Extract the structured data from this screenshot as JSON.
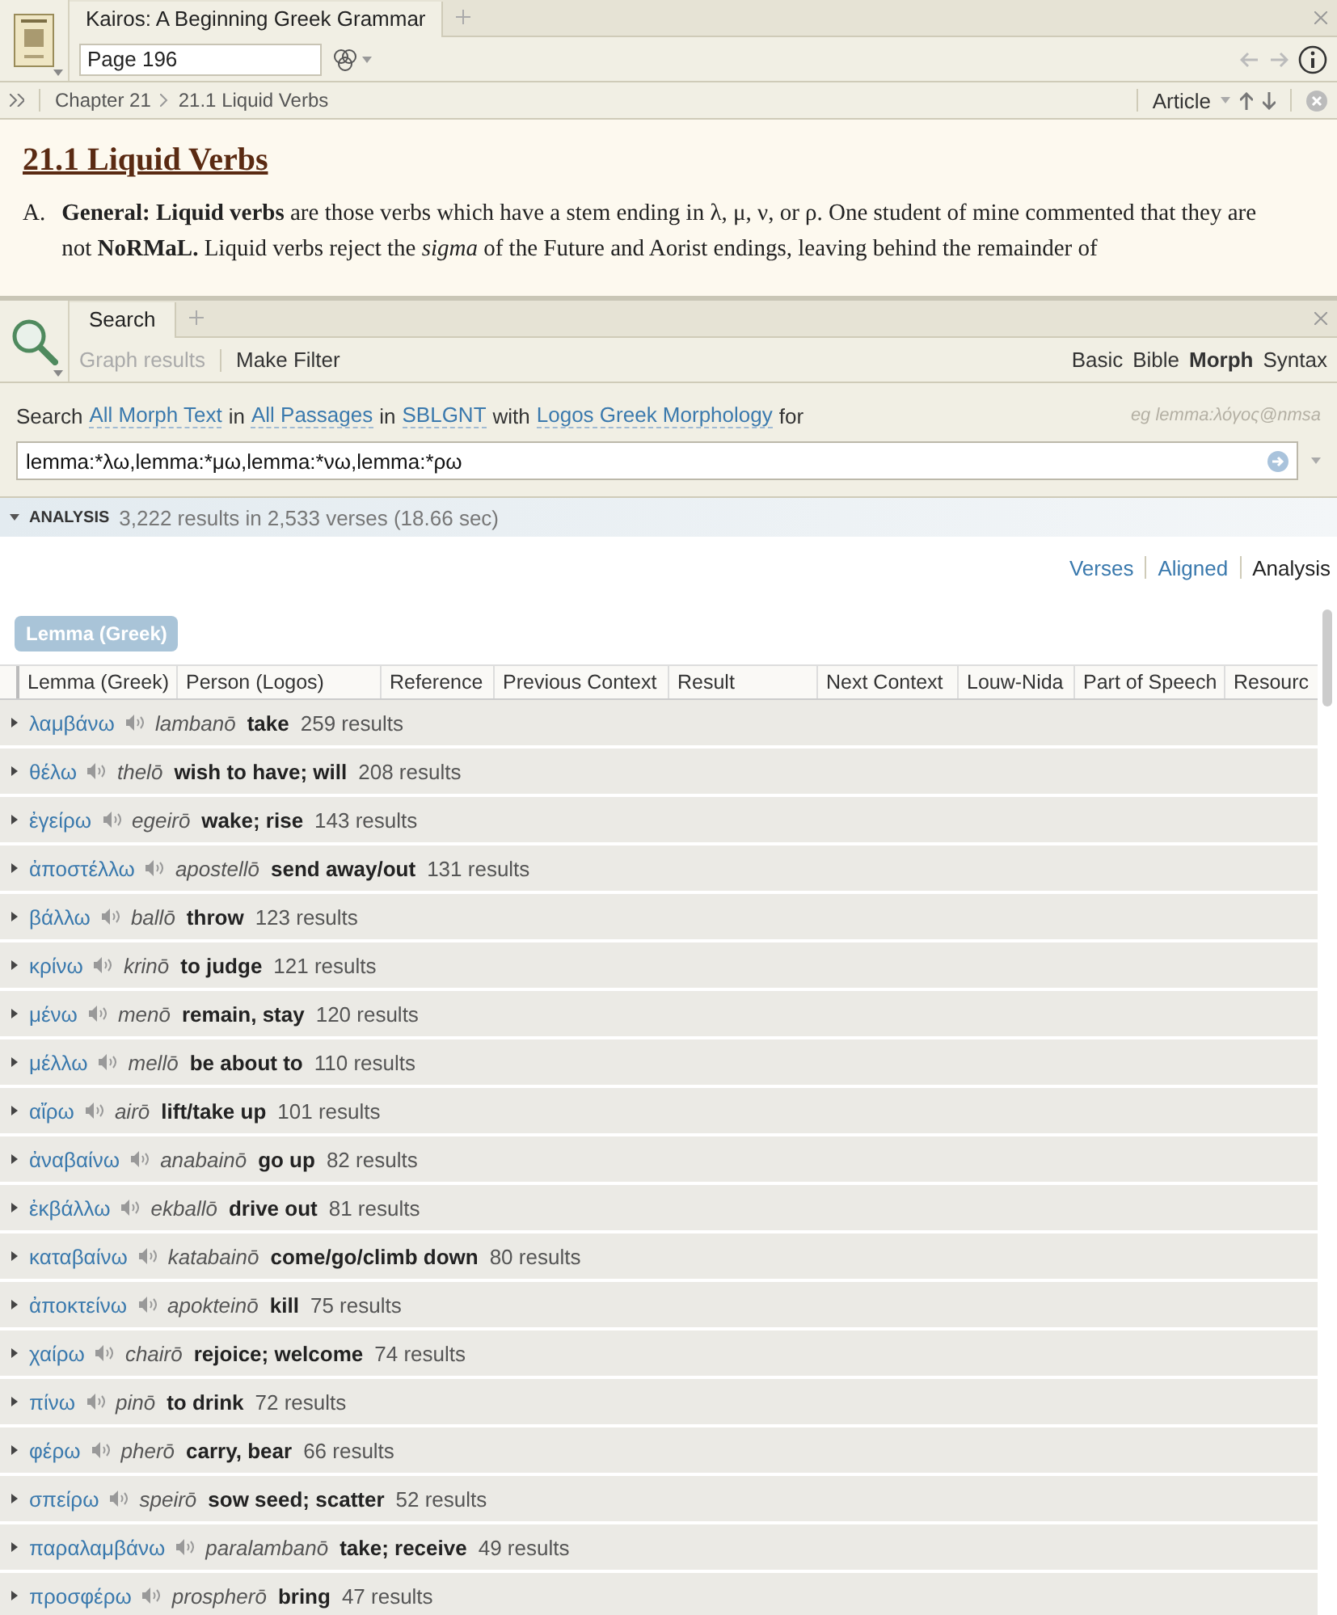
{
  "book_panel": {
    "tab": "Kairos: A Beginning Greek Grammar",
    "page": "Page 196",
    "breadcrumb": [
      "Chapter 21",
      "21.1 Liquid Verbs"
    ],
    "view": "Article",
    "heading": "21.1 Liquid Verbs",
    "paragraph_marker": "A.",
    "paragraph": "**General: Liquid verbs** are those verbs which have a stem ending in λ, μ, ν, or ρ. One student of mine commented that they are not **NoRMaL.** Liquid verbs reject the *sigma* of the Future and Aorist endings, leaving behind the remainder of"
  },
  "search_panel": {
    "tab": "Search",
    "graph_results": {
      "label": "Graph results",
      "disabled": true
    },
    "make_filter": {
      "label": "Make Filter",
      "disabled": false
    },
    "modes": [
      {
        "label": "Basic",
        "selected": false
      },
      {
        "label": "Bible",
        "selected": false
      },
      {
        "label": "Morph",
        "selected": true
      },
      {
        "label": "Syntax",
        "selected": false
      }
    ],
    "query_line": [
      {
        "kind": "text",
        "text": "Search"
      },
      {
        "kind": "link",
        "text": "All Morph Text"
      },
      {
        "kind": "text",
        "text": "in"
      },
      {
        "kind": "link",
        "text": "All Passages"
      },
      {
        "kind": "text",
        "text": "in"
      },
      {
        "kind": "link",
        "text": "SBLGNT"
      },
      {
        "kind": "text",
        "text": "with"
      },
      {
        "kind": "link",
        "text": "Logos Greek Morphology"
      },
      {
        "kind": "text",
        "text": "for"
      }
    ],
    "example": "eg lemma:λόγος@nmsa",
    "query": "lemma:*λω,lemma:*μω,lemma:*νω,lemma:*ρω",
    "analysis_label": "ANALYSIS",
    "summary": "3,222 results in 2,533 verses (18.66 sec)",
    "views": [
      {
        "label": "Verses",
        "selected": false
      },
      {
        "label": "Aligned",
        "selected": false
      },
      {
        "label": "Analysis",
        "selected": true
      }
    ],
    "group_chip": "Lemma (Greek)",
    "columns": [
      "Lemma (Greek)",
      "Person (Logos)",
      "Reference",
      "Previous Context",
      "Result",
      "Next Context",
      "Louw-Nida",
      "Part of Speech",
      "Resourc"
    ],
    "rows": [
      {
        "lemma": "λαμβάνω",
        "translit": "lambanō",
        "gloss": "take",
        "count": "259 results"
      },
      {
        "lemma": "θέλω",
        "translit": "thelō",
        "gloss": "wish to have; will",
        "count": "208 results"
      },
      {
        "lemma": "ἐγείρω",
        "translit": "egeirō",
        "gloss": "wake; rise",
        "count": "143 results"
      },
      {
        "lemma": "ἀποστέλλω",
        "translit": "apostellō",
        "gloss": "send away/out",
        "count": "131 results"
      },
      {
        "lemma": "βάλλω",
        "translit": "ballō",
        "gloss": "throw",
        "count": "123 results"
      },
      {
        "lemma": "κρίνω",
        "translit": "krinō",
        "gloss": "to judge",
        "count": "121 results"
      },
      {
        "lemma": "μένω",
        "translit": "menō",
        "gloss": "remain, stay",
        "count": "120 results"
      },
      {
        "lemma": "μέλλω",
        "translit": "mellō",
        "gloss": "be about to",
        "count": "110 results"
      },
      {
        "lemma": "αἴρω",
        "translit": "airō",
        "gloss": "lift/take up",
        "count": "101 results"
      },
      {
        "lemma": "ἀναβαίνω",
        "translit": "anabainō",
        "gloss": "go up",
        "count": "82 results"
      },
      {
        "lemma": "ἐκβάλλω",
        "translit": "ekballō",
        "gloss": "drive out",
        "count": "81 results"
      },
      {
        "lemma": "καταβαίνω",
        "translit": "katabainō",
        "gloss": "come/go/climb down",
        "count": "80 results"
      },
      {
        "lemma": "ἀποκτείνω",
        "translit": "apokteinō",
        "gloss": "kill",
        "count": "75 results"
      },
      {
        "lemma": "χαίρω",
        "translit": "chairō",
        "gloss": "rejoice; welcome",
        "count": "74 results"
      },
      {
        "lemma": "πίνω",
        "translit": "pinō",
        "gloss": "to drink",
        "count": "72 results"
      },
      {
        "lemma": "φέρω",
        "translit": "pherō",
        "gloss": "carry, bear",
        "count": "66 results"
      },
      {
        "lemma": "σπείρω",
        "translit": "speirō",
        "gloss": "sow seed; scatter",
        "count": "52 results"
      },
      {
        "lemma": "παραλαμβάνω",
        "translit": "paralambanō",
        "gloss": "take; receive",
        "count": "49 results"
      },
      {
        "lemma": "προσφέρω",
        "translit": "prospherō",
        "gloss": "bring",
        "count": "47 results"
      }
    ]
  }
}
